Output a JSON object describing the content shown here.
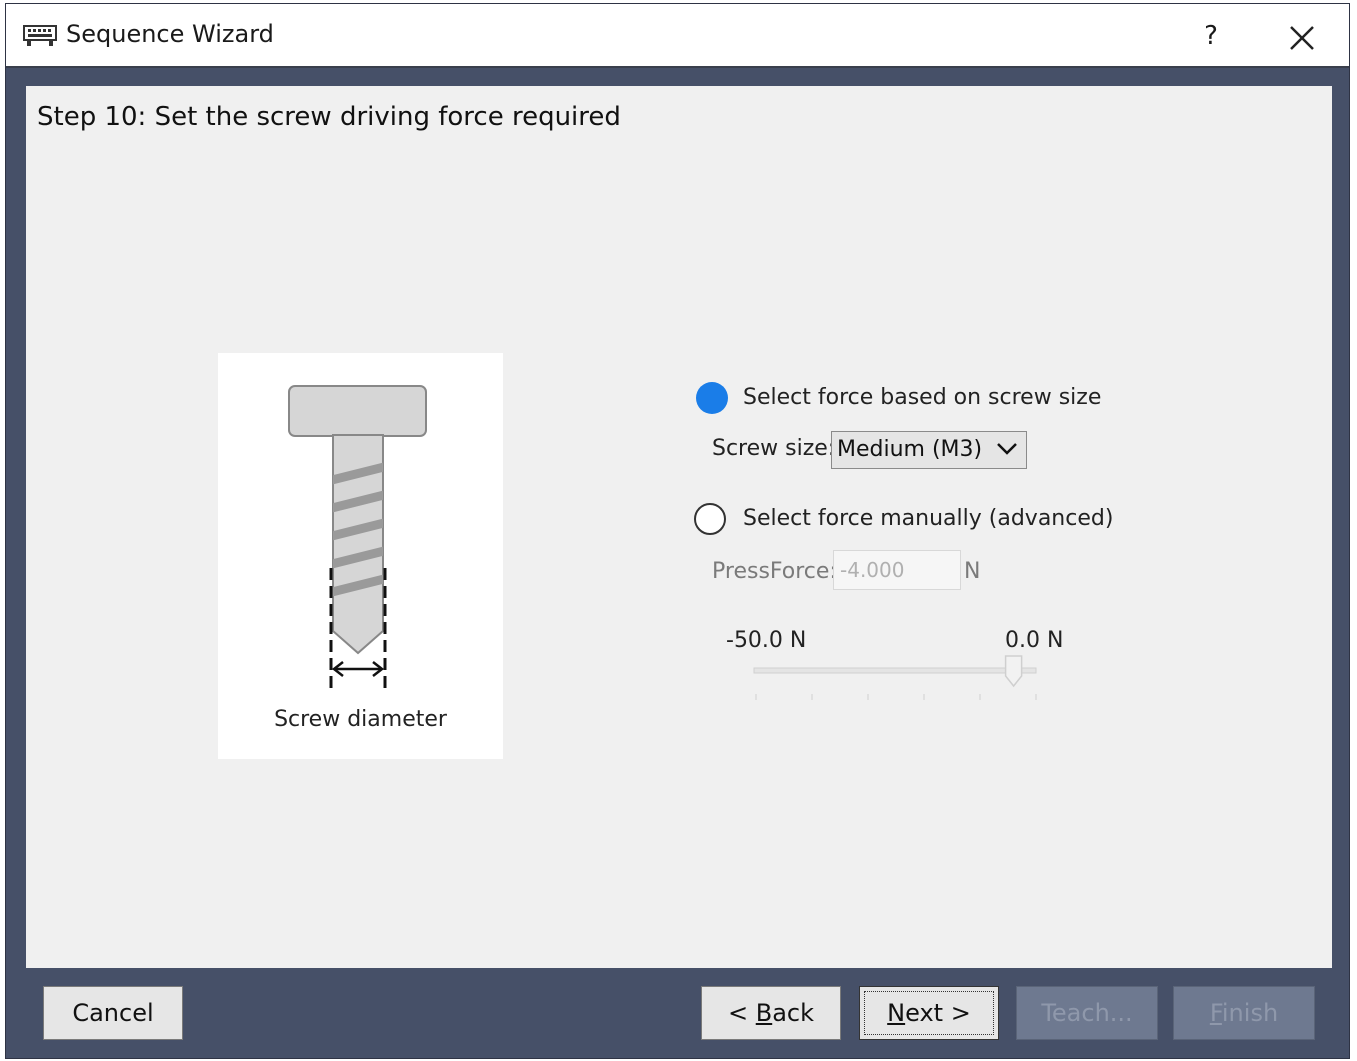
{
  "window": {
    "title": "Sequence Wizard",
    "help_label": "?"
  },
  "step": {
    "title": "Step 10: Set the screw driving force required"
  },
  "figure": {
    "caption": "Screw diameter"
  },
  "options": {
    "by_size": {
      "label": "Select force based on screw size",
      "selected": true
    },
    "manual": {
      "label": "Select force manually (advanced)",
      "selected": false
    }
  },
  "screw_size": {
    "label": "Screw size:",
    "value": "Medium (M3)"
  },
  "press_force": {
    "label": "PressForce:",
    "value": "-4.000",
    "unit": "N"
  },
  "slider": {
    "min_label": "-50.0 N",
    "max_label": "0.0 N",
    "min": -50.0,
    "max": 0.0,
    "value": -4.0
  },
  "buttons": {
    "cancel": "Cancel",
    "back_prefix": "< ",
    "back_mnemonic": "B",
    "back_rest": "ack",
    "next_mnemonic": "N",
    "next_rest": "ext >",
    "teach": "Teach...",
    "finish_mnemonic": "F",
    "finish_rest": "inish"
  },
  "colors": {
    "radio_selected": "#1a7de8",
    "button_bar": "#465068"
  }
}
